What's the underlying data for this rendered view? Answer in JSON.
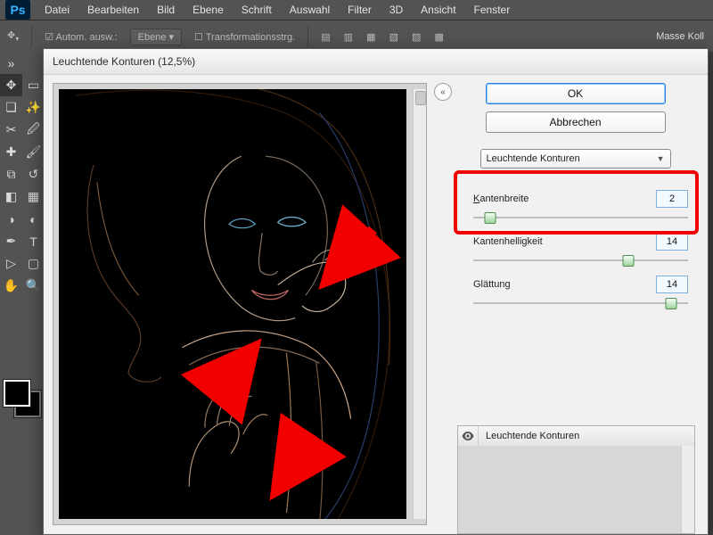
{
  "menubar": {
    "items": [
      "Datei",
      "Bearbeiten",
      "Bild",
      "Ebene",
      "Schrift",
      "Auswahl",
      "Filter",
      "3D",
      "Ansicht",
      "Fenster"
    ]
  },
  "optionsbar": {
    "auto_label": "Autom. ausw.:",
    "auto_target": "Ebene",
    "transform_label": "Transformationsstrg.",
    "right_label_partial": "Masse Koll"
  },
  "dialog": {
    "title": "Leuchtende Konturen (12,5%)",
    "ok": "OK",
    "cancel": "Abbrechen",
    "filter_select": "Leuchtende Konturen",
    "params": {
      "p1_label": "Kantenbreite",
      "p1_value": "2",
      "p2_label": "Kantenhelligkeit",
      "p2_value": "14",
      "p3_label": "Glättung",
      "p3_value": "14"
    },
    "layer_list_label": "Leuchtende Konturen"
  },
  "icons": {
    "eye": "visibility-icon"
  }
}
